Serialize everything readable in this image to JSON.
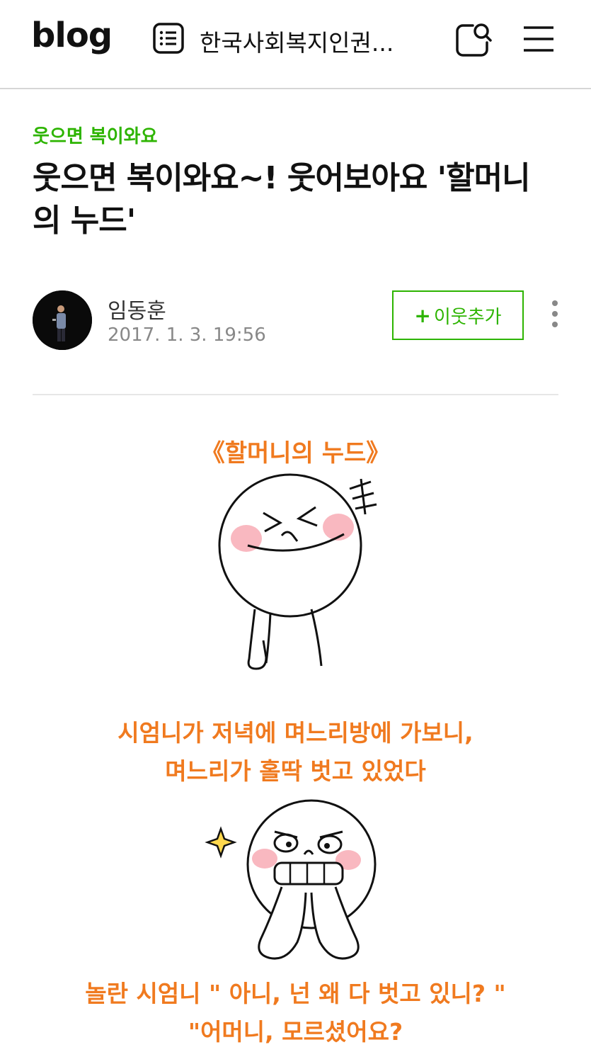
{
  "header": {
    "logo": "blog",
    "blog_name": "한국사회복지인권...",
    "icons": [
      "list-icon",
      "search-icon",
      "menu-icon"
    ]
  },
  "post": {
    "category": "웃으면 복이와요",
    "title": "웃으면 복이와요~! 웃어보아요 '할머니의 누드'",
    "author": "임동훈",
    "date": "2017. 1. 3. 19:56",
    "neighbor_button_plus": "+",
    "neighbor_button_label": "이웃추가"
  },
  "content": {
    "subheading": "《할머니의 누드》",
    "paragraph1": [
      "시엄니가 저녁에 며느리방에 가보니,",
      "며느리가 홀딱 벗고 있었다"
    ],
    "paragraph2": [
      "놀란 시엄니 \" 아니, 넌 왜 다 벗고 있니? \"",
      "\"어머니, 모르셨어요?"
    ]
  },
  "colors": {
    "accent_green": "#2db400",
    "text_orange": "#f07a1f",
    "blush_pink": "#f9b8c0"
  }
}
